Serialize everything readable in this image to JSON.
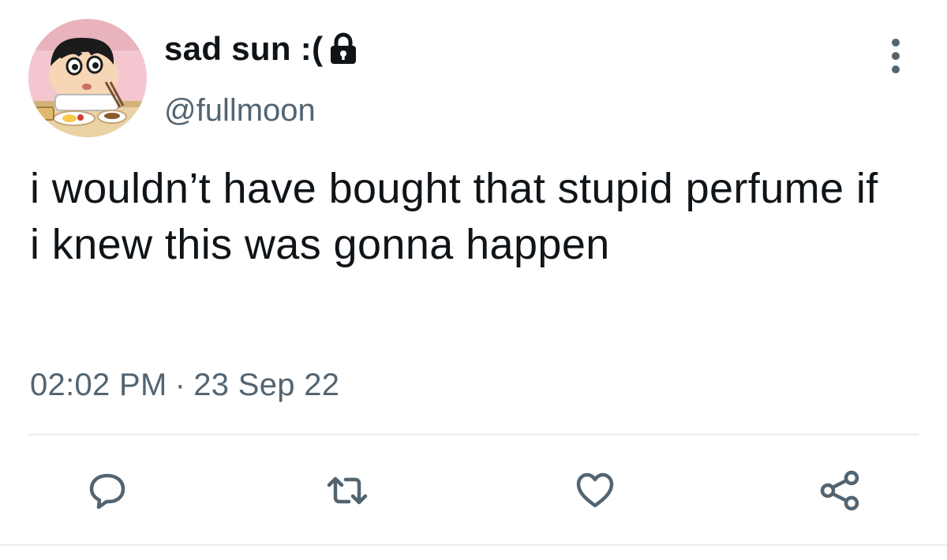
{
  "user": {
    "display_name": "sad sun :(",
    "handle": "@fullmoon",
    "protected_icon": "lock-icon",
    "avatar": "cartoon-boy-avatar"
  },
  "tweet": {
    "text": "i wouldn’t have bought that stupid perfume if i knew this was gonna happen",
    "time": "02:02 PM",
    "separator": "·",
    "date": "23 Sep 22"
  },
  "actions": {
    "more": "more-options-icon",
    "reply": "reply-icon",
    "retweet": "retweet-icon",
    "like": "like-icon",
    "share": "share-icon"
  },
  "colors": {
    "text": "#0f1419",
    "secondary": "#536471",
    "icon": "#536471",
    "divider": "#e6ecf0"
  }
}
